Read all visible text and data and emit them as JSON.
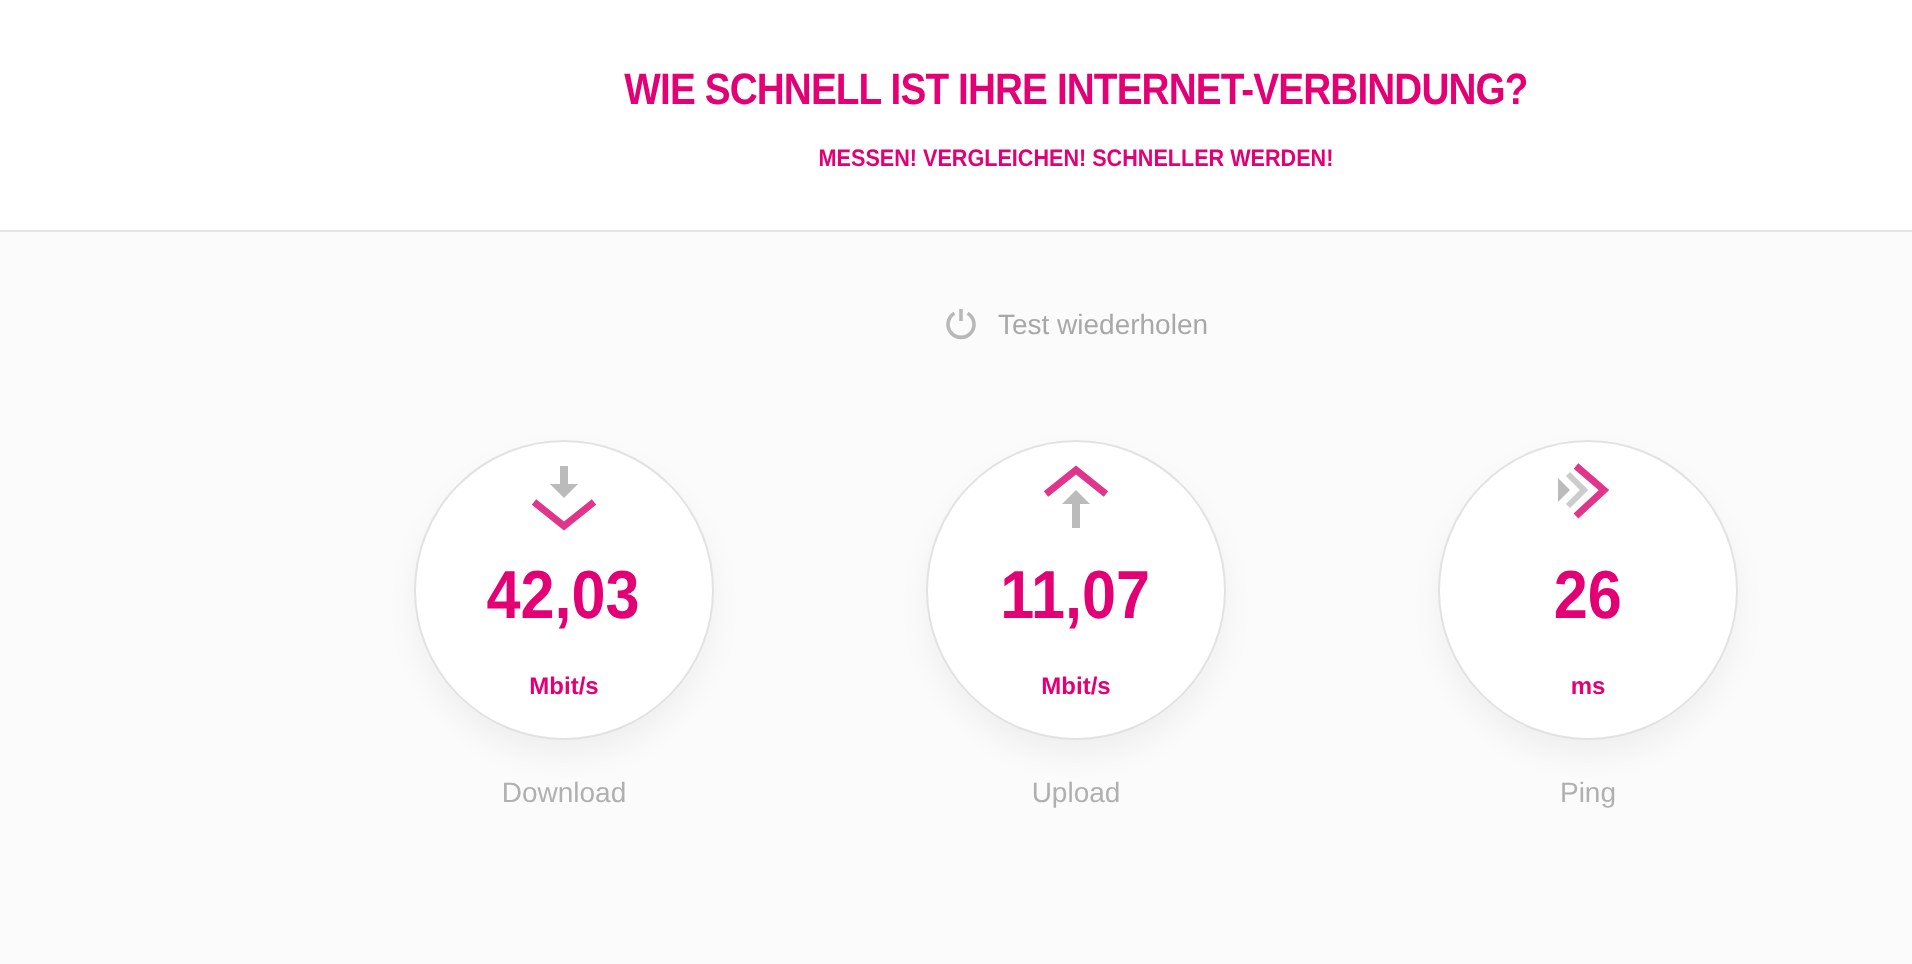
{
  "header": {
    "title": "WIE SCHNELL IST IHRE INTERNET-VERBINDUNG?",
    "subtitle": "MESSEN! VERGLEICHEN! SCHNELLER WERDEN!"
  },
  "retest": {
    "label": "Test wiederholen"
  },
  "metrics": [
    {
      "kind": "download",
      "value": "42,03",
      "unit": "Mbit/s",
      "label": "Download"
    },
    {
      "kind": "upload",
      "value": "11,07",
      "unit": "Mbit/s",
      "label": "Upload"
    },
    {
      "kind": "ping",
      "value": "26",
      "unit": "ms",
      "label": "Ping"
    }
  ]
}
